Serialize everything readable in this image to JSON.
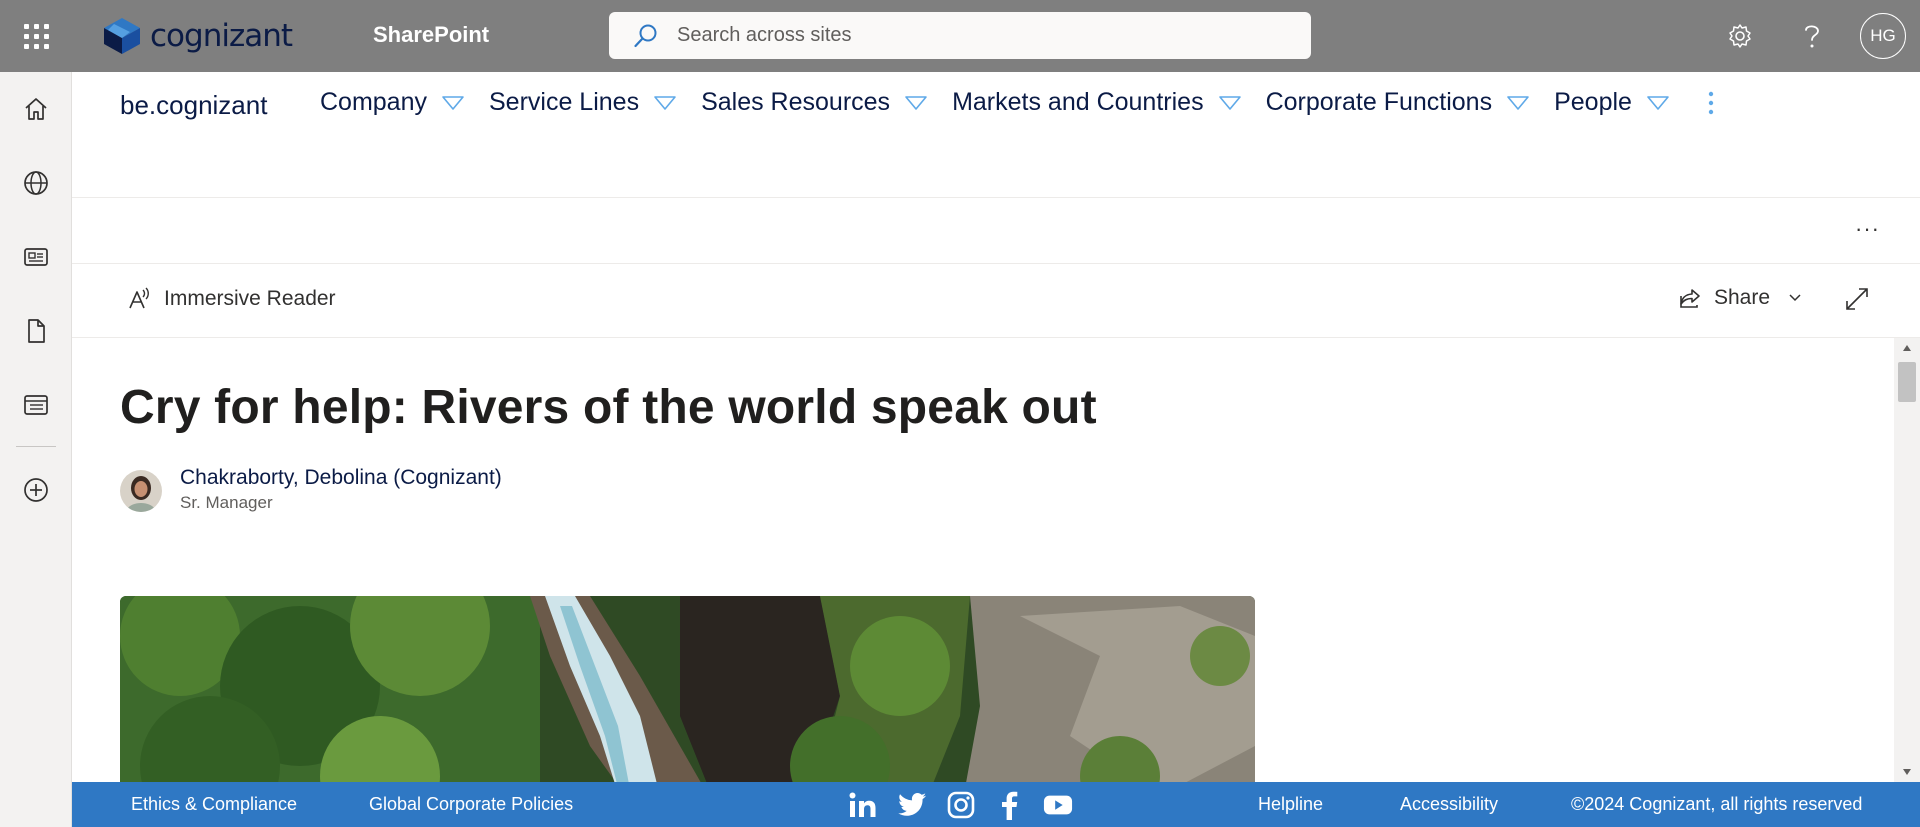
{
  "suite_bar": {
    "brand_name": "cognizant",
    "product_name": "SharePoint",
    "search_placeholder": "Search across sites",
    "user_initials": "HG",
    "background_color": "#7f7f7f"
  },
  "app_bar": {
    "items": [
      "home-icon",
      "globe-icon",
      "news-icon",
      "file-icon",
      "list-icon",
      "add-circle-icon"
    ]
  },
  "site_header": {
    "site_title": "be.cognizant",
    "nav_items": [
      {
        "label": "Company"
      },
      {
        "label": "Service Lines"
      },
      {
        "label": "Sales Resources"
      },
      {
        "label": "Markets and Countries"
      },
      {
        "label": "Corporate Functions"
      },
      {
        "label": "People"
      }
    ]
  },
  "command_bar": {
    "more_label": "···"
  },
  "page_toolbar": {
    "immersive_reader_label": "Immersive Reader",
    "share_label": "Share"
  },
  "article": {
    "title": "Cry for help: Rivers of the world speak out",
    "author_name": "Chakraborty, Debolina (Cognizant)",
    "author_role": "Sr. Manager"
  },
  "footer": {
    "links_left": [
      "Ethics & Compliance",
      "Global Corporate Policies"
    ],
    "social_icons": [
      "linkedin-icon",
      "twitter-icon",
      "instagram-icon",
      "facebook-icon",
      "youtube-icon"
    ],
    "links_right": [
      "Helpline",
      "Accessibility"
    ],
    "copyright": "©2024 Cognizant, all rights reserved",
    "background_color": "#2f78c4"
  }
}
